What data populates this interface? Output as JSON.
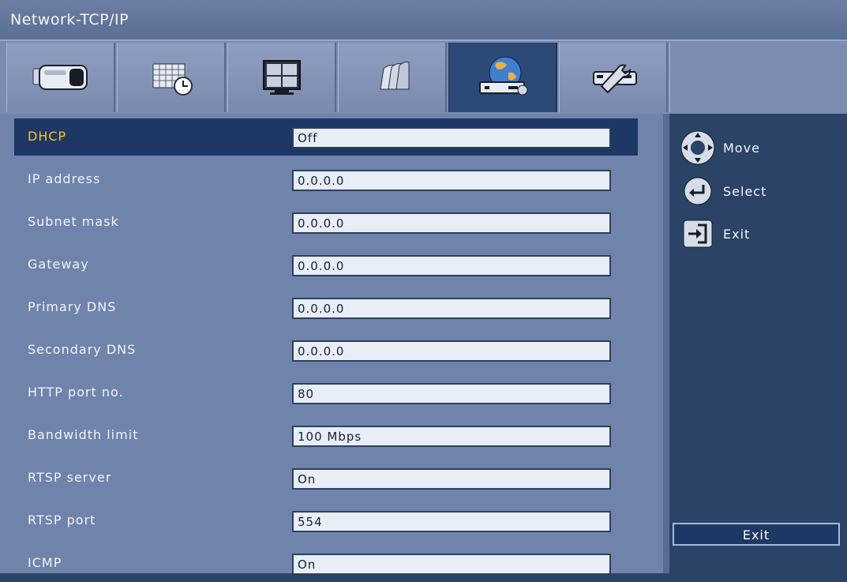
{
  "window": {
    "title": "Network-TCP/IP"
  },
  "tabs": [
    {
      "icon": "camera-icon",
      "active": false
    },
    {
      "icon": "schedule-icon",
      "active": false
    },
    {
      "icon": "monitor-icon",
      "active": false
    },
    {
      "icon": "storage-icon",
      "active": false
    },
    {
      "icon": "network-icon",
      "active": true
    },
    {
      "icon": "tools-icon",
      "active": false
    }
  ],
  "settings": [
    {
      "label": "DHCP",
      "value": "Off",
      "selected": true
    },
    {
      "label": "IP address",
      "value": "0.0.0.0"
    },
    {
      "label": "Subnet mask",
      "value": "0.0.0.0"
    },
    {
      "label": "Gateway",
      "value": "0.0.0.0"
    },
    {
      "label": "Primary DNS",
      "value": "0.0.0.0"
    },
    {
      "label": "Secondary DNS",
      "value": "0.0.0.0"
    },
    {
      "label": "HTTP port no.",
      "value": "80"
    },
    {
      "label": "Bandwidth limit",
      "value": "100 Mbps"
    },
    {
      "label": "RTSP server",
      "value": "On"
    },
    {
      "label": "RTSP port",
      "value": "554"
    },
    {
      "label": "ICMP",
      "value": "On"
    }
  ],
  "hints": {
    "move": "Move",
    "select": "Select",
    "exit": "Exit"
  },
  "exit_button": "Exit",
  "colors": {
    "selected_label": "#ffc21a",
    "selected_row": "#1e3866",
    "panel": "#7083ab",
    "background": "#2a4366"
  }
}
